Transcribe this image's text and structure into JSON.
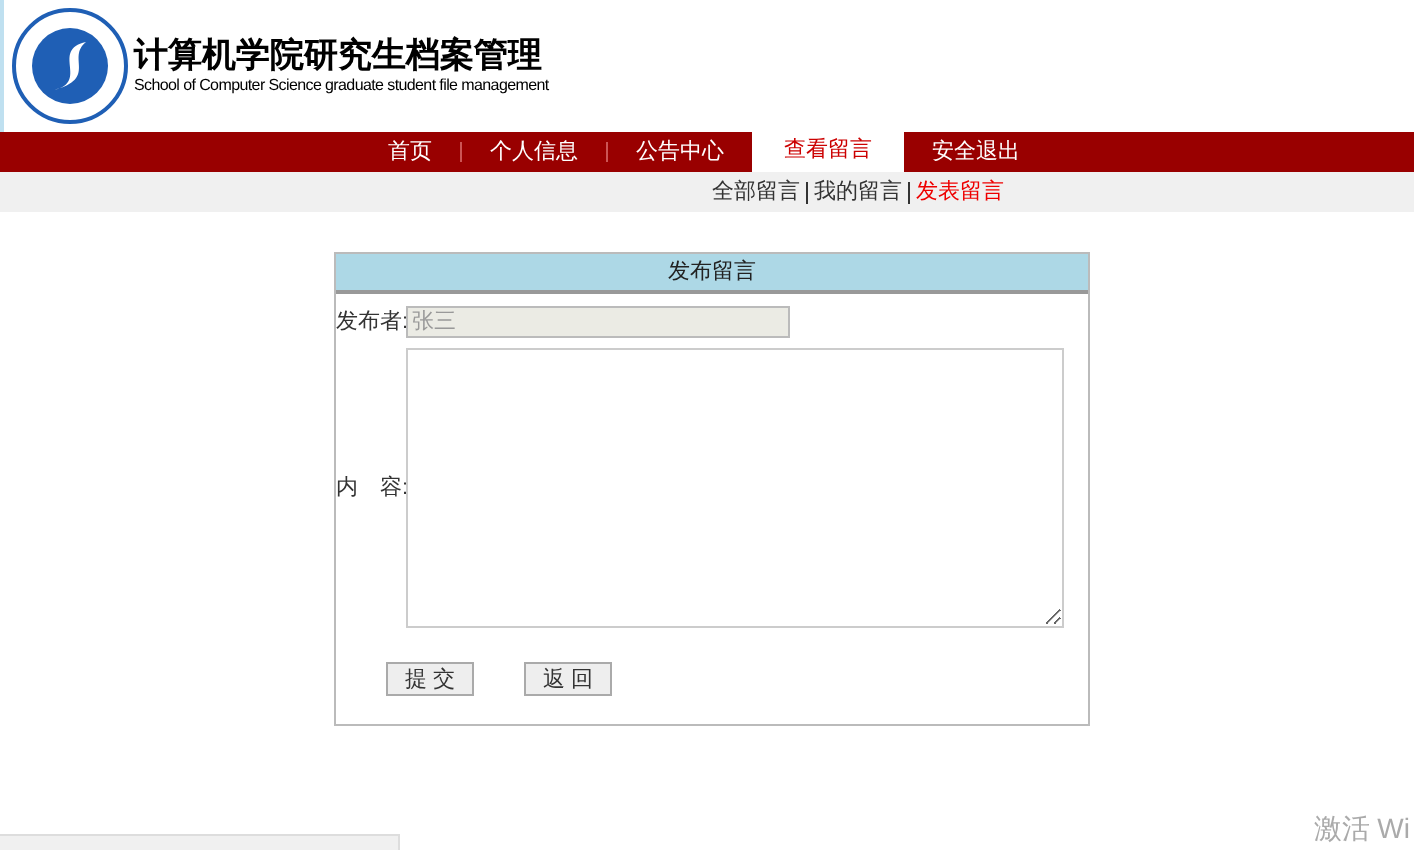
{
  "header": {
    "title": "计算机学院研究生档案管理",
    "subtitle": "School of Computer Science graduate student file management"
  },
  "nav": [
    {
      "label": "首页",
      "selected": false
    },
    {
      "label": "个人信息",
      "selected": false
    },
    {
      "label": "公告中心",
      "selected": false
    },
    {
      "label": "查看留言",
      "selected": true
    },
    {
      "label": "安全退出",
      "selected": false
    }
  ],
  "subnav": [
    {
      "label": "全部留言",
      "selected": false
    },
    {
      "label": "我的留言",
      "selected": false
    },
    {
      "label": "发表留言",
      "selected": true
    }
  ],
  "form": {
    "title": "发布留言",
    "author_label": "发布者:",
    "author_value": "张三",
    "content_label": "内　容:",
    "buttons": [
      "提 交",
      "返 回"
    ]
  },
  "system_overlay": "激活 Wi"
}
